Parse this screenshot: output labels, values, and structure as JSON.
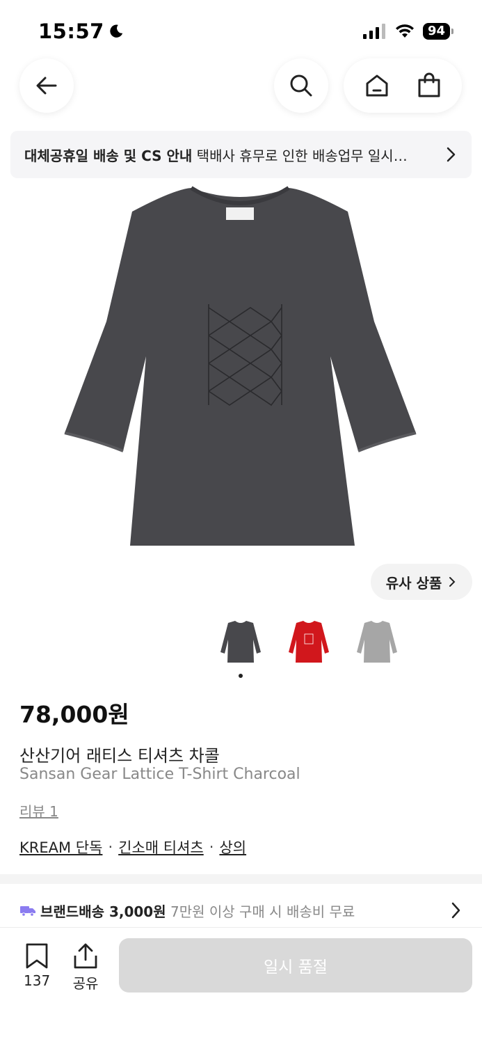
{
  "status_bar": {
    "time": "15:57",
    "battery": "94"
  },
  "header": {
    "icons": [
      "back-arrow-icon",
      "search-icon",
      "home-icon",
      "shopping-bag-icon"
    ]
  },
  "notice": {
    "title": "대체공휴일 배송 및 CS 안내",
    "text": "택배사 휴무로 인한 배송업무 일시…"
  },
  "similar": {
    "label": "유사 상품"
  },
  "colors": {
    "charcoal": "#48484c",
    "red": "#d1171c",
    "gray": "#a6a6a6",
    "soldout": "#d9d9d9",
    "truck": "#8b7cf0"
  },
  "product": {
    "price": "78,000원",
    "title_ko": "산산기어 래티스 티셔츠 차콜",
    "title_en": "Sansan Gear Lattice T-Shirt Charcoal",
    "review": "리뷰 1",
    "tags": [
      "KREAM 단독",
      "긴소매 티셔츠",
      "상의"
    ],
    "tag_separator": "·"
  },
  "shipping": {
    "label": "브랜드배송 3,000원",
    "sub": "7만원 이상 구매 시 배송비 무료"
  },
  "bottom": {
    "bookmark_count": "137",
    "share_label": "공유",
    "buy_button": "일시 품절"
  }
}
